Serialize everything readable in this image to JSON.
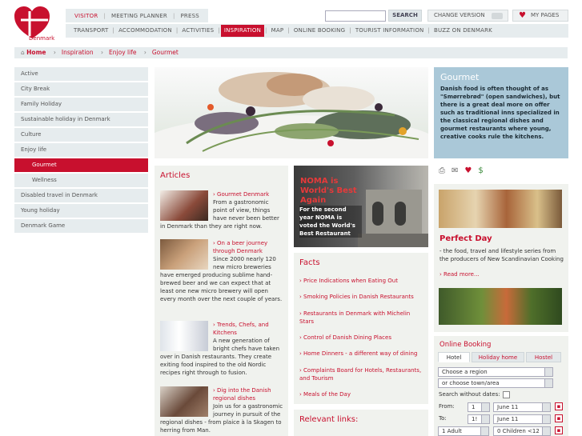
{
  "header": {
    "logo_text": "Denmark",
    "top_nav": [
      {
        "label": "VISITOR",
        "active": true
      },
      {
        "label": "MEETING PLANNER",
        "active": false
      },
      {
        "label": "PRESS",
        "active": false
      }
    ],
    "search_placeholder": "",
    "search_label": "SEARCH",
    "change_version_label": "CHANGE VERSION",
    "my_pages_label": "MY PAGES",
    "main_nav": [
      {
        "label": "TRANSPORT",
        "active": false
      },
      {
        "label": "ACCOMMODATION",
        "active": false
      },
      {
        "label": "ACTIVITIES",
        "active": false
      },
      {
        "label": "INSPIRATION",
        "active": true
      },
      {
        "label": "MAP",
        "active": false
      },
      {
        "label": "ONLINE BOOKING",
        "active": false
      },
      {
        "label": "TOURIST INFORMATION",
        "active": false
      },
      {
        "label": "BUZZ ON DENMARK",
        "active": false
      }
    ]
  },
  "breadcrumb": [
    "Home",
    "Inspiration",
    "Enjoy life",
    "Gourmet"
  ],
  "sidebar": {
    "items": [
      {
        "label": "Active",
        "sub": false,
        "active": false
      },
      {
        "label": "City Break",
        "sub": false,
        "active": false
      },
      {
        "label": "Family Holiday",
        "sub": false,
        "active": false
      },
      {
        "label": "Sustainable holiday in Denmark",
        "sub": false,
        "active": false
      },
      {
        "label": "Culture",
        "sub": false,
        "active": false
      },
      {
        "label": "Enjoy life",
        "sub": false,
        "active": false
      },
      {
        "label": "Gourmet",
        "sub": true,
        "active": true
      },
      {
        "label": "Wellness",
        "sub": true,
        "active": false
      },
      {
        "label": "Disabled travel in Denmark",
        "sub": false,
        "active": false
      },
      {
        "label": "Young holiday",
        "sub": false,
        "active": false
      },
      {
        "label": "Denmark Game",
        "sub": false,
        "active": false
      }
    ]
  },
  "gourmet": {
    "title": "Gourmet",
    "text": "Danish food is often thought of as \"Smørrebrød\" (open sandwiches), but there is a great deal more on offer such as traditional inns specialized in the classical regional dishes and gourmet restaurants where young, creative cooks rule the kitchens."
  },
  "articles": {
    "title": "Articles",
    "items": [
      {
        "title": "› Gourmet Denmark",
        "text": "From a gastronomic point of view, things have never been better in Denmark than they are right now."
      },
      {
        "title": "› On a beer journey through Denmark",
        "text": "Since 2000 nearly 120 new micro breweries have emerged producing sublime hand-brewed beer and we can expect that at least one new micro brewery will open every month over the next couple of years."
      },
      {
        "title": "› Trends, Chefs, and Kitchens",
        "text": "A new generation of bright chefs have taken over in Danish restaurants. They create exiting food inspired to the old Nordic recipes right through to fusion."
      },
      {
        "title": "› Dig into the Danish regional dishes",
        "text": "Join us for a gastronomic journey in pursuit of the regional dishes - from plaice à la Skagen to herring from Man."
      }
    ]
  },
  "noma": {
    "title": "NOMA is World's Best Again",
    "text": "For the second year NOMA is voted the World's Best Restaurant"
  },
  "facts": {
    "title": "Facts",
    "items": [
      "› Price Indications when Eating Out",
      "› Smoking Policies in Danish Restaurants",
      "› Restaurants in Denmark with Michelin Stars",
      "› Control of Danish Dining Places",
      "› Home Dinners - a different way of dining",
      "› Complaints Board for Hotels, Restaurants, and Tourism",
      "› Meals of the Day"
    ]
  },
  "relevant_links": {
    "title": "Relevant links:"
  },
  "perfect_day": {
    "title": "Perfect Day",
    "text": "- the food, travel and lifestyle series from the producers of New Scandinavian Cooking",
    "more": "› Read more..."
  },
  "booking": {
    "title": "Online Booking",
    "tabs": [
      "Hotel",
      "Holiday home",
      "Hostel"
    ],
    "region": "Choose a region",
    "town": "or choose town/area",
    "search_without_dates": "Search without dates:",
    "from_label": "From:",
    "to_label": "To:",
    "from_day": "1",
    "from_month": "June 11",
    "to_day": "1!",
    "to_month": "June 11",
    "adults": "1 Adult",
    "children": "0 Children <12"
  }
}
